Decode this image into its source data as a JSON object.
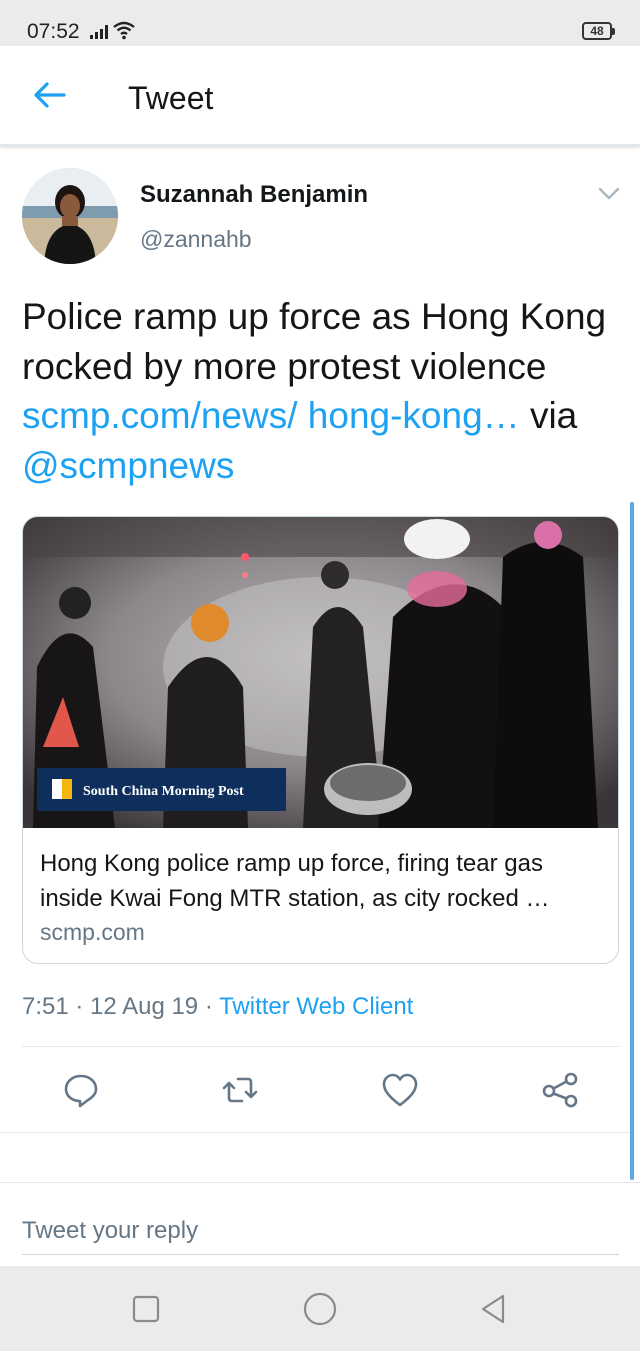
{
  "status_bar": {
    "time": "07:52",
    "battery": "48"
  },
  "header": {
    "title": "Tweet"
  },
  "tweet": {
    "author_name": "Suzannah Benjamin",
    "author_handle": "@zannahb",
    "text_plain": "Police ramp up force as Hong Kong rocked by more protest violence ",
    "link_url": "scmp.com/news/ hong-kong…",
    "text_via": " via ",
    "mention": "@scmpnews",
    "meta_time": "7:51",
    "meta_sep1": " · ",
    "meta_date": "12 Aug 19",
    "meta_sep2": " · ",
    "meta_client": "Twitter Web Client"
  },
  "card": {
    "logo_text": "South China Morning Post",
    "title": "Hong Kong police ramp up force, firing tear gas inside Kwai Fong MTR station, as city rocked …",
    "domain": "scmp.com"
  },
  "reply": {
    "placeholder": "Tweet your reply"
  },
  "colors": {
    "accent": "#1da1f2",
    "secondary_text": "#657786",
    "primary_text": "#14171a",
    "divider": "#e1e8ed"
  },
  "icons": {
    "back": "arrow-left-icon",
    "menu": "chevron-down-icon",
    "reply": "comment-icon",
    "retweet": "retweet-icon",
    "like": "heart-icon",
    "share": "share-icon",
    "nav_recents": "square-icon",
    "nav_home": "circle-icon",
    "nav_back": "triangle-back-icon"
  }
}
